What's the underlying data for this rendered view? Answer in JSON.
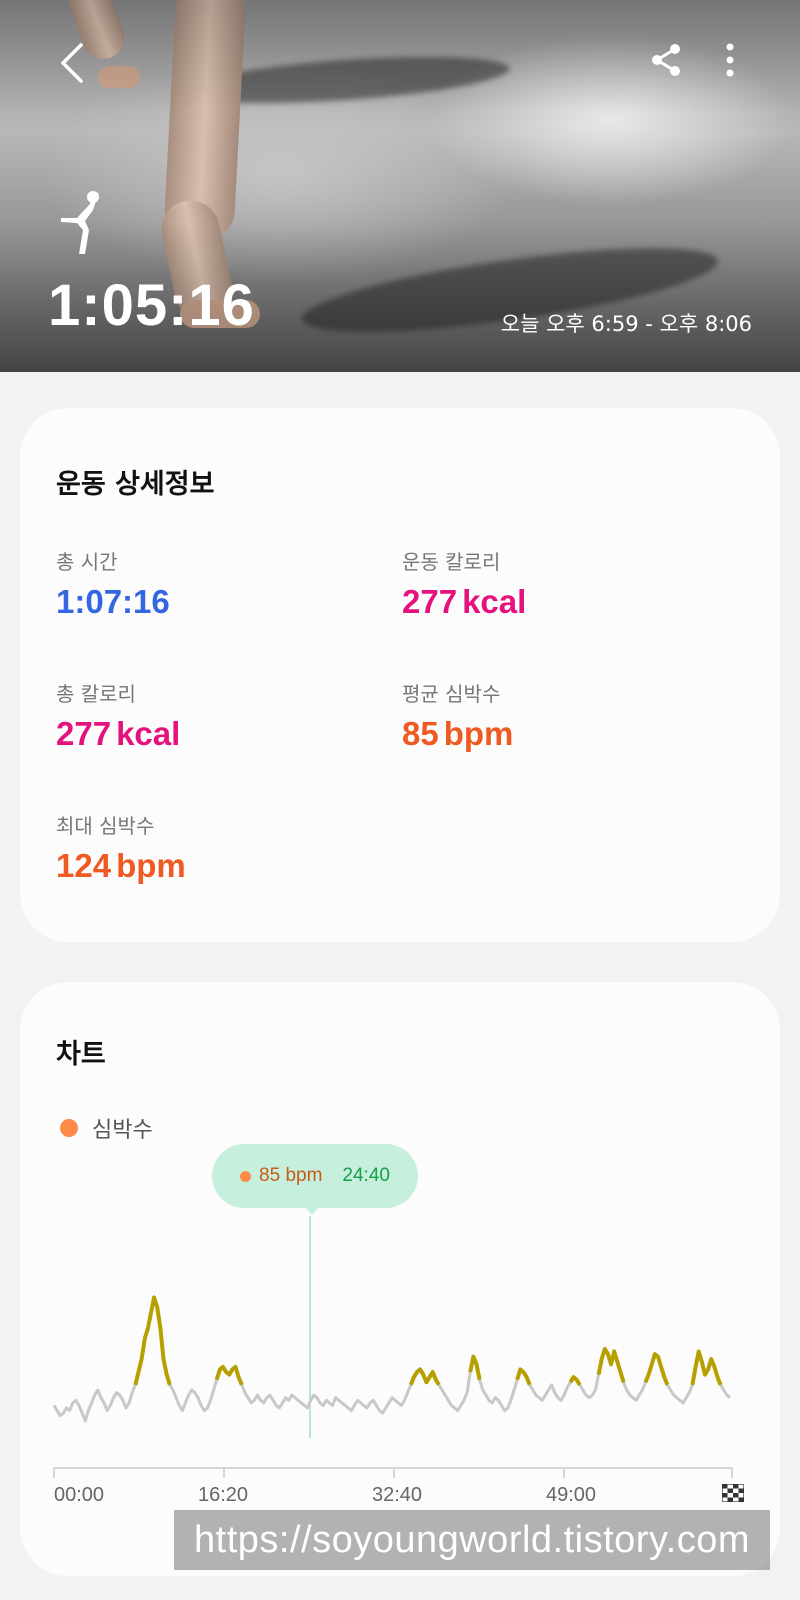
{
  "header": {
    "duration": "1:05:16",
    "time_range": "오늘 오후 6:59 - 오후 8:06",
    "activity_icon": "dance-icon",
    "back_icon": "chevron-left-icon",
    "share_icon": "share-icon",
    "more_icon": "more-vertical-icon"
  },
  "details": {
    "title": "운동 상세정보",
    "stats": [
      {
        "label": "총 시간",
        "value": "1:07:16",
        "unit": "",
        "color": "#3366e0"
      },
      {
        "label": "운동 칼로리",
        "value": "277",
        "unit": "kcal",
        "color": "#e5127d"
      },
      {
        "label": "총 칼로리",
        "value": "277",
        "unit": "kcal",
        "color": "#e5127d"
      },
      {
        "label": "평균 심박수",
        "value": "85",
        "unit": "bpm",
        "color": "#ee5a22"
      },
      {
        "label": "최대 심박수",
        "value": "124",
        "unit": "bpm",
        "color": "#ee5a22"
      }
    ]
  },
  "chart": {
    "title": "차트",
    "legend": "심박수",
    "tooltip_bpm": "85 bpm",
    "tooltip_time": "24:40",
    "ticks": [
      "00:00",
      "16:20",
      "32:40",
      "49:00"
    ],
    "finish_icon": "checkered-flag-icon",
    "line_color": "#c8c8c8",
    "highlight_color": "#b5a000"
  },
  "chart_data": {
    "type": "line",
    "title": "",
    "xlabel": "",
    "ylabel": "",
    "x_ticks": [
      "00:00",
      "16:20",
      "32:40",
      "49:00"
    ],
    "selected": {
      "time": "24:40",
      "bpm": 85
    },
    "series": [
      {
        "name": "심박수",
        "values": [
          82,
          80,
          78,
          79,
          81,
          80,
          83,
          84,
          82,
          79,
          76,
          80,
          83,
          86,
          88,
          85,
          83,
          80,
          82,
          85,
          87,
          86,
          84,
          81,
          83,
          87,
          90,
          95,
          100,
          108,
          112,
          118,
          124,
          120,
          112,
          100,
          94,
          90,
          88,
          85,
          82,
          80,
          83,
          86,
          88,
          87,
          85,
          82,
          80,
          81,
          84,
          88,
          92,
          96,
          97,
          95,
          94,
          96,
          97,
          93,
          90,
          87,
          85,
          83,
          84,
          86,
          84,
          83,
          85,
          86,
          84,
          82,
          81,
          83,
          85,
          84,
          86,
          85,
          84,
          83,
          82,
          81,
          84,
          86,
          85,
          83,
          82,
          84,
          83,
          82,
          85,
          84,
          83,
          82,
          81,
          80,
          82,
          84,
          83,
          82,
          81,
          83,
          84,
          82,
          80,
          79,
          81,
          83,
          85,
          84,
          83,
          82,
          84,
          87,
          90,
          93,
          95,
          96,
          94,
          91,
          93,
          95,
          92,
          90,
          88,
          86,
          84,
          82,
          81,
          80,
          82,
          84,
          87,
          95,
          101,
          98,
          92,
          88,
          86,
          84,
          83,
          85,
          84,
          82,
          80,
          81,
          84,
          88,
          92,
          96,
          95,
          93,
          90,
          88,
          86,
          85,
          84,
          86,
          88,
          90,
          87,
          85,
          84,
          86,
          89,
          91,
          93,
          92,
          90,
          88,
          86,
          85,
          86,
          88,
          94,
          100,
          104,
          102,
          98,
          103,
          99,
          95,
          91,
          88,
          86,
          85,
          84,
          86,
          88,
          91,
          94,
          98,
          102,
          101,
          97,
          93,
          90,
          88,
          86,
          85,
          84,
          83,
          85,
          87,
          90,
          97,
          103,
          99,
          94,
          96,
          100,
          97,
          93,
          90,
          88,
          86,
          85
        ]
      }
    ]
  },
  "watermark": "https://soyoungworld.tistory.com"
}
